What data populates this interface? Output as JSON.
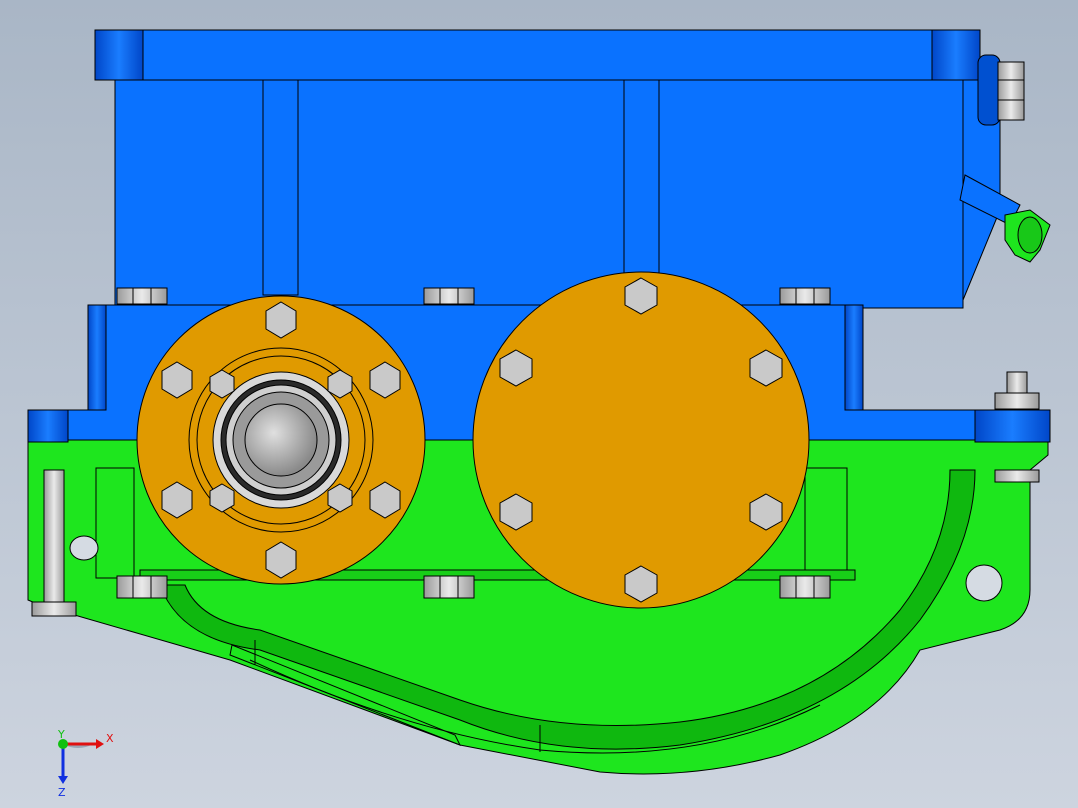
{
  "viewport": {
    "background_top": "#a9b6c6",
    "background_bottom": "#cdd4df"
  },
  "colors": {
    "housing_cover": "#0a72ff",
    "housing_cover_dark": "#0046c8",
    "housing_base": "#1ee61e",
    "housing_base_dark": "#0aa00a",
    "bearing_cap": "#e09a00",
    "bolt": "#c8c8c8",
    "shaft": "#bdbdbd",
    "outline": "#000000",
    "axis_x": "#e01010",
    "axis_y": "#10c010",
    "axis_z": "#1030e0"
  },
  "icons": {
    "triad": "coordinate-triad-icon",
    "bolt": "hex-bolt-icon"
  },
  "triad": {
    "x_label": "X",
    "y_label": "Y",
    "z_label": "Z"
  }
}
